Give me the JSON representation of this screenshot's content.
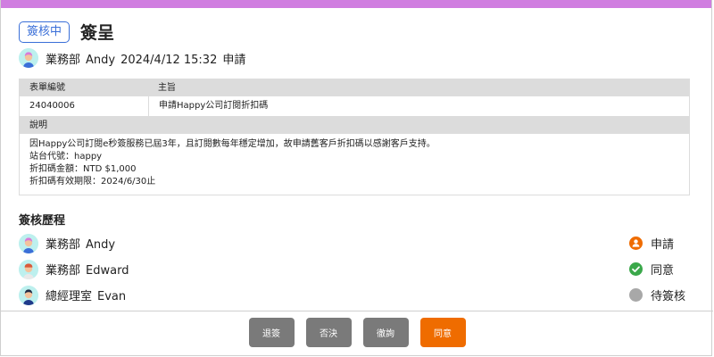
{
  "header": {
    "status": "簽核中",
    "title": "簽呈"
  },
  "applicant": {
    "dept": "業務部",
    "name": "Andy",
    "datetime": "2024/4/12 15:32",
    "action": "申請"
  },
  "form": {
    "headers": {
      "form_no": "表單編號",
      "subject": "主旨"
    },
    "form_no": "24040006",
    "subject": "申請Happy公司訂閱折扣碼",
    "desc_header": "說明",
    "desc_lines": [
      "因Happy公司訂閱e秒簽服務已屆3年，且訂閱數每年穩定增加，故申請舊客戶折扣碼以感謝客戶支持。",
      "站台代號：happy",
      "折扣碼金額：NTD  $1,000",
      "折扣碼有效期限：2024/6/30止"
    ]
  },
  "history": {
    "title": "簽核歷程",
    "items": [
      {
        "dept": "業務部",
        "name": "Andy",
        "status": "申請",
        "status_color": "#ef6c00"
      },
      {
        "dept": "業務部",
        "name": "Edward",
        "status": "同意",
        "status_color": "#3aa84a"
      },
      {
        "dept": "總經理室",
        "name": "Evan",
        "status": "待簽核",
        "status_color": "#a8a8a8"
      }
    ]
  },
  "actions": {
    "return": "退簽",
    "reject": "否決",
    "withdraw": "徹詢",
    "approve": "同意"
  },
  "colors": {
    "accent_bar": "#d07ee0",
    "badge": "#3a6fd8",
    "primary_button": "#ef6c00",
    "secondary_button": "#7a7a7a"
  }
}
